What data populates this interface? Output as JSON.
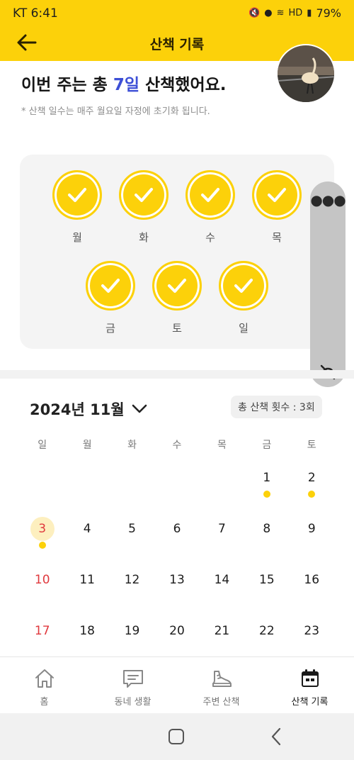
{
  "status_bar": {
    "carrier_time": "KT 6:41",
    "battery": "79%",
    "icons": [
      "mute-icon",
      "location-icon",
      "wifi-icon",
      "hd-icon",
      "signal-icon"
    ]
  },
  "header": {
    "title": "산책 기록"
  },
  "summary": {
    "headline_pre": "이번 주는 총 ",
    "headline_count": "7일",
    "headline_post": " 산책했어요.",
    "note": "* 산책 일수는 매주 월요일 자정에 초기화 됩니다."
  },
  "week_days": [
    {
      "label": "월",
      "checked": true
    },
    {
      "label": "화",
      "checked": true
    },
    {
      "label": "수",
      "checked": true
    },
    {
      "label": "목",
      "checked": true
    },
    {
      "label": "금",
      "checked": true
    },
    {
      "label": "토",
      "checked": true
    },
    {
      "label": "일",
      "checked": true
    }
  ],
  "calendar": {
    "month_label": "2024년 11월",
    "total_walks": "총 산책 횟수 : 3회",
    "weekday_headers": [
      "일",
      "월",
      "화",
      "수",
      "목",
      "금",
      "토"
    ],
    "weeks": [
      [
        "",
        "",
        "",
        "",
        "",
        "1",
        "2"
      ],
      [
        "3",
        "4",
        "5",
        "6",
        "7",
        "8",
        "9"
      ],
      [
        "10",
        "11",
        "12",
        "13",
        "14",
        "15",
        "16"
      ],
      [
        "17",
        "18",
        "19",
        "20",
        "21",
        "22",
        "23"
      ]
    ],
    "walk_days": [
      "1",
      "2",
      "3"
    ],
    "today": "3"
  },
  "bottom_nav": [
    {
      "label": "홈",
      "icon": "home-icon",
      "active": false
    },
    {
      "label": "동네 생활",
      "icon": "chat-icon",
      "active": false
    },
    {
      "label": "주변 산책",
      "icon": "shoe-icon",
      "active": false
    },
    {
      "label": "산책 기록",
      "icon": "calendar-icon",
      "active": true
    }
  ],
  "colors": {
    "accent": "#fcd10a",
    "highlight": "#3d4fd6",
    "sunday": "#e0393e"
  }
}
